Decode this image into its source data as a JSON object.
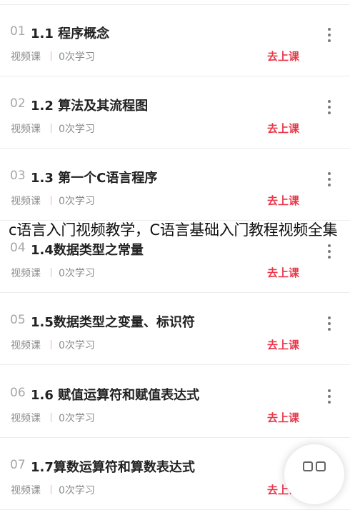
{
  "lessons": [
    {
      "num": "01",
      "title": "1.1 程序概念",
      "type": "视频课",
      "progress": "0次学习",
      "action": "去上课"
    },
    {
      "num": "02",
      "title": "1.2 算法及其流程图",
      "type": "视频课",
      "progress": "0次学习",
      "action": "去上课"
    },
    {
      "num": "03",
      "title": "1.3 第一个C语言程序",
      "type": "视频课",
      "progress": "0次学习",
      "action": "去上课"
    },
    {
      "num": "04",
      "title": "1.4数据类型之常量",
      "type": "视频课",
      "progress": "0次学习",
      "action": "去上课"
    },
    {
      "num": "05",
      "title": "1.5数据类型之变量、标识符",
      "type": "视频课",
      "progress": "0次学习",
      "action": "去上课"
    },
    {
      "num": "06",
      "title": "1.6 赋值运算符和赋值表达式",
      "type": "视频课",
      "progress": "0次学习",
      "action": "去上课"
    },
    {
      "num": "07",
      "title": "1.7算数运算符和算数表达式",
      "type": "视频课",
      "progress": "0次学习",
      "action": "去上课"
    }
  ],
  "overlay_caption": "c语言入门视频教学，C语言基础入门教程视频全集",
  "icons": {
    "more": "more-vertical-icon",
    "fab": "floating-menu-icon"
  },
  "colors": {
    "accent": "#e8384a",
    "text": "#222222",
    "muted": "#8c8c8c"
  }
}
